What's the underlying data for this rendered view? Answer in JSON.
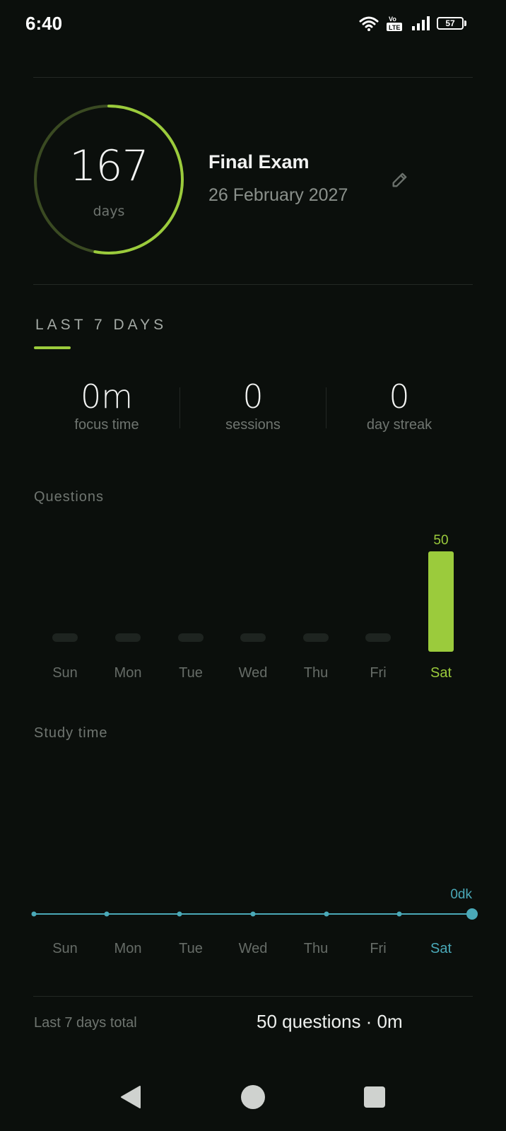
{
  "status_bar": {
    "time": "6:40",
    "battery": "57"
  },
  "countdown": {
    "days_value": "167",
    "days_label": "days",
    "progress_fraction": 0.53,
    "ring_color": "#9bcb3c",
    "ring_track_color": "#3a4a22"
  },
  "exam": {
    "title": "Final Exam",
    "date": "26 February 2027"
  },
  "section": {
    "label": "LAST 7 DAYS"
  },
  "stats": [
    {
      "value": "0m",
      "label": "focus time"
    },
    {
      "value": "0",
      "label": "sessions"
    },
    {
      "value": "0",
      "label": "day streak"
    }
  ],
  "questions_chart": {
    "label": "Questions",
    "chart_data": {
      "type": "bar",
      "categories": [
        "Sun",
        "Mon",
        "Tue",
        "Wed",
        "Thu",
        "Fri",
        "Sat"
      ],
      "values": [
        0,
        0,
        0,
        0,
        0,
        0,
        50
      ],
      "highlight_index": 6,
      "value_label": "50",
      "bar_color": "#9bcb3c",
      "empty_color": "#1e2420"
    }
  },
  "study_chart": {
    "label": "Study time",
    "chart_data": {
      "type": "line",
      "categories": [
        "Sun",
        "Mon",
        "Tue",
        "Wed",
        "Thu",
        "Fri",
        "Sat"
      ],
      "values": [
        0,
        0,
        0,
        0,
        0,
        0,
        0
      ],
      "highlight_index": 6,
      "value_label": "0dk",
      "line_color": "#4aa9b8"
    }
  },
  "footer": {
    "label": "Last 7 days total",
    "value": "50 questions · 0m"
  }
}
